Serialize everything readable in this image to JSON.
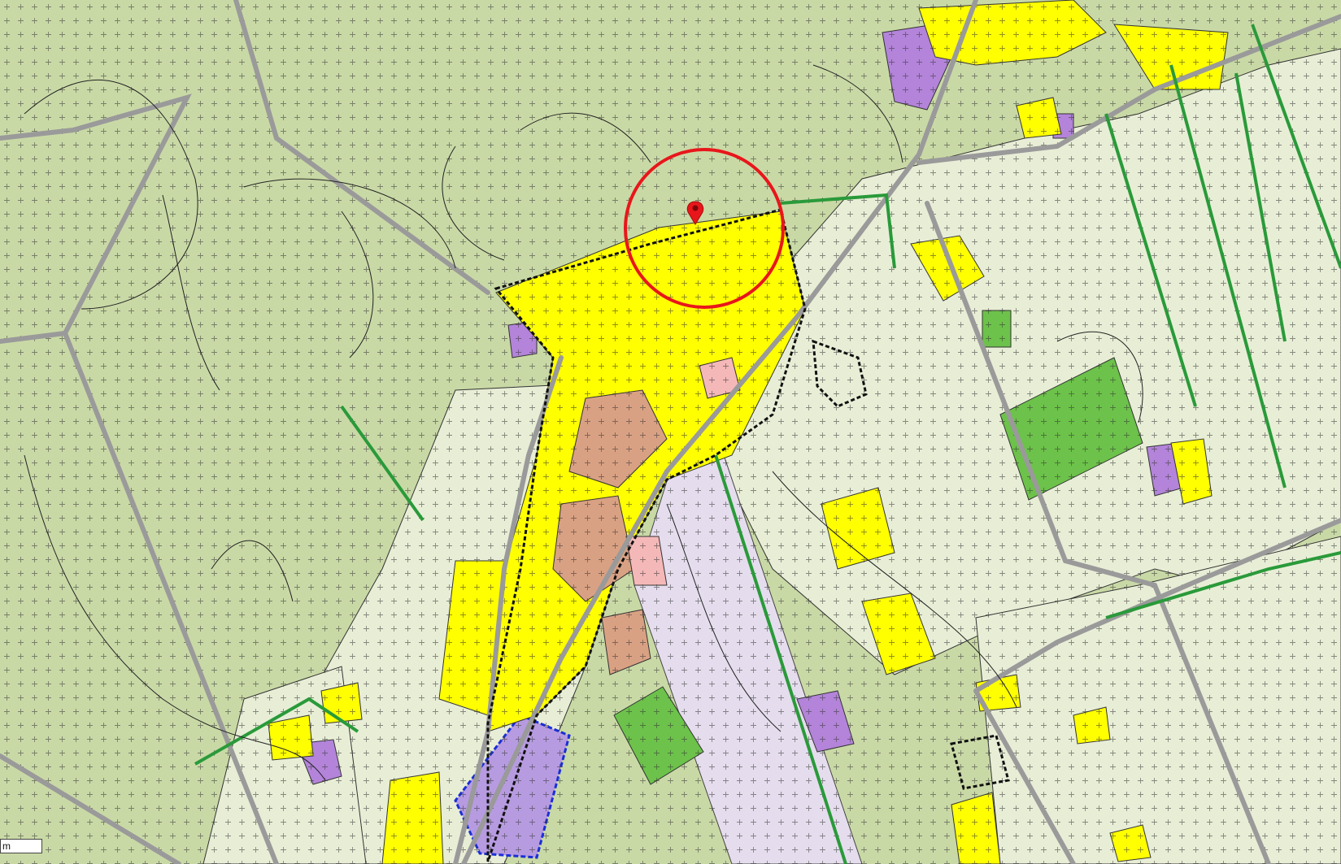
{
  "map": {
    "scale_label": "m",
    "colors": {
      "agricultural": "#c9d9a6",
      "agricultural_light": "#e8eed6",
      "residential": "#ffff00",
      "historic_core": "#d9a183",
      "services": "#b384d9",
      "green_park": "#6cc24a",
      "infrastructure_band": "#e5dded",
      "pink_zone": "#f5b8b8",
      "roads": "#b9b9b9",
      "boundary": "#111111",
      "blue_boundary": "#1a2fd6",
      "green_lines": "#2a9a3a",
      "marker": "#e8161b"
    },
    "marker": {
      "icon": "map-pin-icon",
      "highlight": "red-circle"
    }
  }
}
